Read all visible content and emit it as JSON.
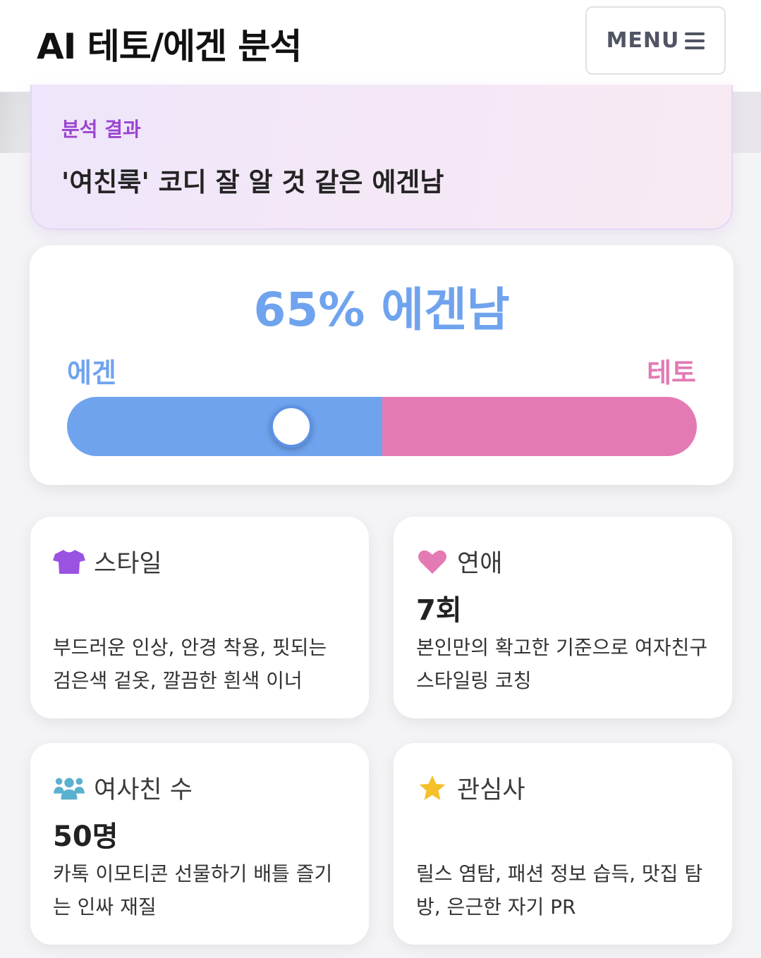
{
  "header": {
    "title": "AI 테토/에겐 분석",
    "menu_label": "MENU"
  },
  "result": {
    "label": "분석 결과",
    "text": "'여친룩' 코디 잘 알 것 같은 에겐남"
  },
  "ratio": {
    "headline": "65% 에겐남",
    "left_label": "에겐",
    "right_label": "테토",
    "egen_fraction": 0.5,
    "thumb_position": 0.356,
    "colors": {
      "egen": "#6fa3ee",
      "teto": "#e47ab3"
    }
  },
  "cards": [
    {
      "icon": "shirt-icon",
      "title": "스타일",
      "value": "",
      "desc": "부드러운 인상, 안경 착용, 핏되는 검은색 겉옷, 깔끔한 흰색 이너"
    },
    {
      "icon": "heart-icon",
      "title": "연애",
      "value": "7회",
      "desc": "본인만의 확고한 기준으로 여자친구 스타일링 코칭"
    },
    {
      "icon": "users-icon",
      "title": "여사친 수",
      "value": "50명",
      "desc": "카톡 이모티콘 선물하기 배틀 즐기는 인싸 재질"
    },
    {
      "icon": "star-icon",
      "title": "관심사",
      "value": "",
      "desc": "릴스 염탐, 패션 정보 습득, 맛집 탐방, 은근한 자기 PR"
    }
  ]
}
